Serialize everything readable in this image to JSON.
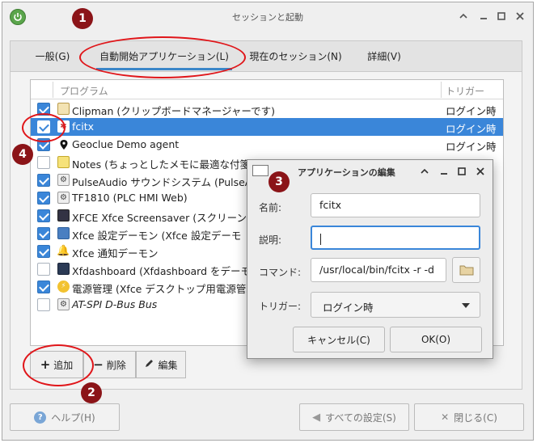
{
  "window": {
    "title": "セッションと起動"
  },
  "tabs": [
    {
      "label": "一般(G)"
    },
    {
      "label": "自動開始アプリケーション(L)"
    },
    {
      "label": "現在のセッション(N)"
    },
    {
      "label": "詳細(V)"
    }
  ],
  "list": {
    "headers": {
      "program": "プログラム",
      "trigger": "トリガー"
    },
    "rows": [
      {
        "name": "Clipman (クリップボードマネージャーです)",
        "trigger": "ログイン時",
        "checked": true,
        "selected": false
      },
      {
        "name": "fcitx",
        "trigger": "ログイン時",
        "checked": true,
        "selected": true
      },
      {
        "name": "Geoclue Demo agent",
        "trigger": "ログイン時",
        "checked": true,
        "selected": false
      },
      {
        "name": "Notes (ちょっとしたメモに最適な付箋紙",
        "trigger": "",
        "checked": false,
        "selected": false
      },
      {
        "name": "PulseAudio サウンドシステム (PulseA",
        "trigger": "",
        "checked": true,
        "selected": false
      },
      {
        "name": "TF1810 (PLC HMI Web)",
        "trigger": "",
        "checked": true,
        "selected": false
      },
      {
        "name": "XFCE Xfce Screensaver (スクリーンセ",
        "trigger": "",
        "checked": true,
        "selected": false
      },
      {
        "name": "Xfce 設定デーモン (Xfce 設定デーモ",
        "trigger": "",
        "checked": true,
        "selected": false
      },
      {
        "name": "Xfce 通知デーモン",
        "trigger": "",
        "checked": true,
        "selected": false
      },
      {
        "name": "Xfdashboard (Xfdashboard をデーモ",
        "trigger": "",
        "checked": false,
        "selected": false
      },
      {
        "name": "電源管理 (Xfce デスクトップ用電源管理",
        "trigger": "",
        "checked": true,
        "selected": false
      },
      {
        "name": "AT-SPI D-Bus Bus",
        "trigger": "",
        "checked": false,
        "selected": false
      }
    ]
  },
  "toolbar": {
    "add": "追加",
    "remove": "削除",
    "edit": "編集"
  },
  "bottom": {
    "help": "ヘルプ(H)",
    "all_settings": "すべての設定(S)",
    "close": "閉じる(C)"
  },
  "dialog": {
    "title": "アプリケーションの編集",
    "name_label": "名前:",
    "name_value": "fcitx",
    "desc_label": "説明:",
    "desc_value": "",
    "command_label": "コマンド:",
    "command_value": "/usr/local/bin/fcitx -r -d",
    "trigger_label": "トリガー:",
    "trigger_value": "ログイン時",
    "cancel": "キャンセル(C)",
    "ok": "OK(O)"
  },
  "annotations": {
    "one": "1",
    "two": "2",
    "three": "3",
    "four": "4"
  },
  "colors": {
    "accent": "#3a86d9",
    "annotation_red": "#e0161a",
    "badge": "#8b1418"
  }
}
